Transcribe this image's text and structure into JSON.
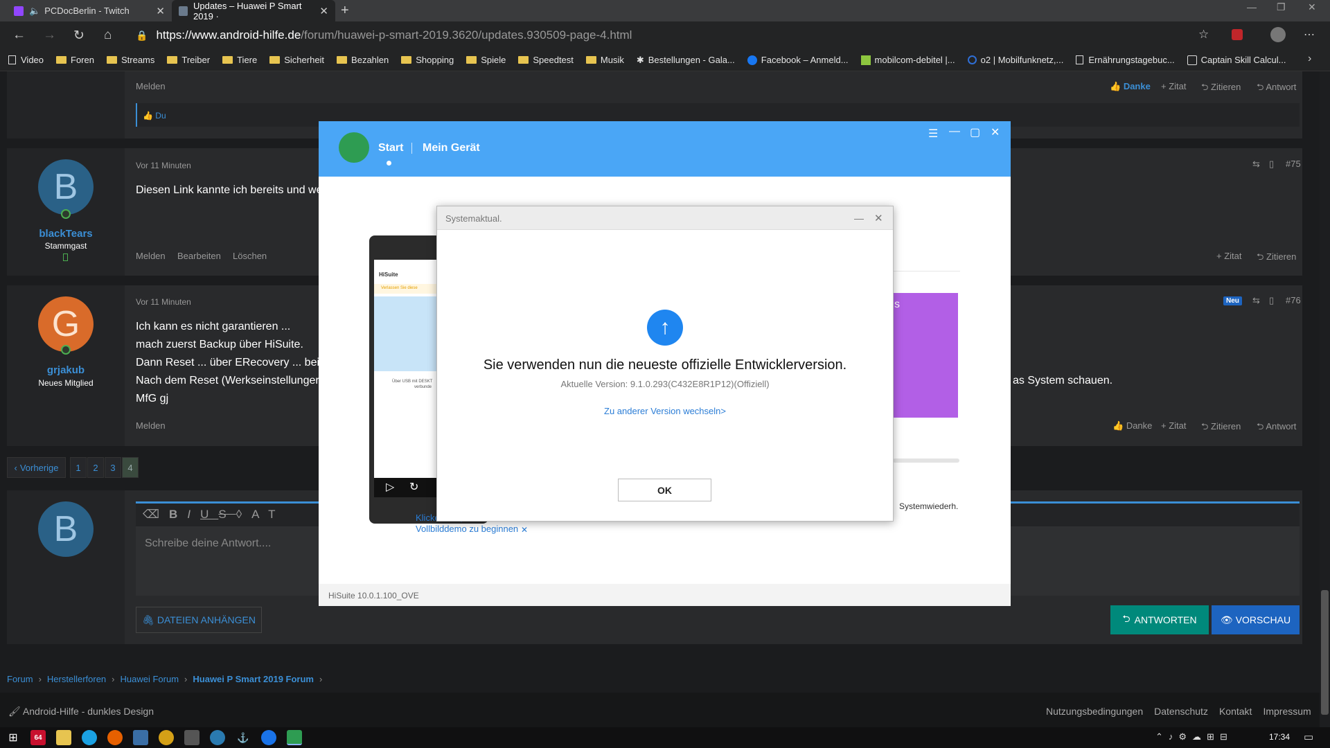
{
  "browser": {
    "tabs": [
      {
        "title": "PCDocBerlin - Twitch",
        "active": false
      },
      {
        "title": "Updates – Huawei P Smart 2019 ·",
        "active": true
      }
    ],
    "url_host": "https://www.android-hilfe.de",
    "url_path": "/forum/huawei-p-smart-2019.3620/updates.930509-page-4.html",
    "bookmarks": [
      "Video",
      "Foren",
      "Streams",
      "Treiber",
      "Tiere",
      "Sicherheit",
      "Bezahlen",
      "Shopping",
      "Spiele",
      "Speedtest",
      "Musik",
      "Bestellungen - Gala...",
      "Facebook – Anmeld...",
      "mobilcom-debitel |...",
      "o2 | Mobilfunknetz,...",
      "Ernährungstagebuc...",
      "Captain Skill Calcul..."
    ]
  },
  "forum": {
    "post74": {
      "report": "Melden",
      "thanks": "Danke",
      "quote": "Zitat",
      "cite": "Zitieren",
      "reply": "Antwort",
      "liked_by": "Du"
    },
    "post75": {
      "time": "Vor 11 Minuten",
      "number": "#75",
      "avatar_letter": "B",
      "user": "blackTears",
      "rank": "Stammgast",
      "text": "Diesen Link kannte ich bereits und we",
      "actions": [
        "Melden",
        "Bearbeiten",
        "Löschen"
      ],
      "quote": "Zitat",
      "cite": "Zitieren"
    },
    "post76": {
      "time": "Vor 11 Minuten",
      "number": "#76",
      "new_badge": "Neu",
      "avatar_letter": "G",
      "user": "grjakub",
      "rank": "Neues Mitglied",
      "lines": [
        "Ich kann es nicht garantieren ...",
        "mach zuerst Backup über HiSuite.",
        "Dann Reset ... über ERecovery ... bei",
        "Nach dem Reset (Werkseinstellunger",
        "MfG gj"
      ],
      "right_fragment": "as System schauen.",
      "report": "Melden",
      "thanks": "Danke",
      "quote": "Zitat",
      "cite": "Zitieren",
      "reply": "Antwort"
    },
    "pagination": {
      "prev": "Vorherige",
      "pages": [
        "1",
        "2",
        "3",
        "4"
      ],
      "current": "4"
    },
    "reply_box": {
      "avatar_letter": "B",
      "placeholder": "Schreibe deine Antwort....",
      "attach": "DATEIEN ANHÄNGEN",
      "submit": "ANTWORTEN",
      "preview": "VORSCHAU"
    },
    "breadcrumb": [
      "Forum",
      "Herstellerforen",
      "Huawei Forum",
      "Huawei P Smart 2019 Forum"
    ],
    "footer": {
      "theme": "Android-Hilfe - dunkles Design",
      "links": [
        "Nutzungsbedingungen",
        "Datenschutz",
        "Kontakt",
        "Impressum"
      ]
    }
  },
  "hisuite": {
    "nav": [
      "Start",
      "Mein Gerät"
    ],
    "phone_app_title": "HiSuite",
    "phone_warning": "Verlassen Sie diese",
    "phone_usb": "Über USB mit DESKT",
    "phone_usb2": "verbunde",
    "promo_fragment": "s",
    "restore_label": "Systemwiederh.",
    "demo_hint": "Klicken Sie, um mit einer Vollbilddemo zu beginnen",
    "version_footer": "HiSuite 10.0.1.100_OVE",
    "dialog": {
      "title": "Systemaktual.",
      "headline": "Sie verwenden nun die neueste offizielle Entwicklerversion.",
      "version": "Aktuelle Version: 9.1.0.293(C432E8R1P12)(Offiziell)",
      "link": "Zu anderer Version wechseln>",
      "ok": "OK"
    }
  },
  "taskbar": {
    "time": "17:34",
    "badge": "64"
  },
  "colors": {
    "forum_blue": "#3b8fd6",
    "hisuite_blue": "#4aa6f6",
    "green_btn": "#00897b",
    "purple_card": "#b25fe6"
  }
}
